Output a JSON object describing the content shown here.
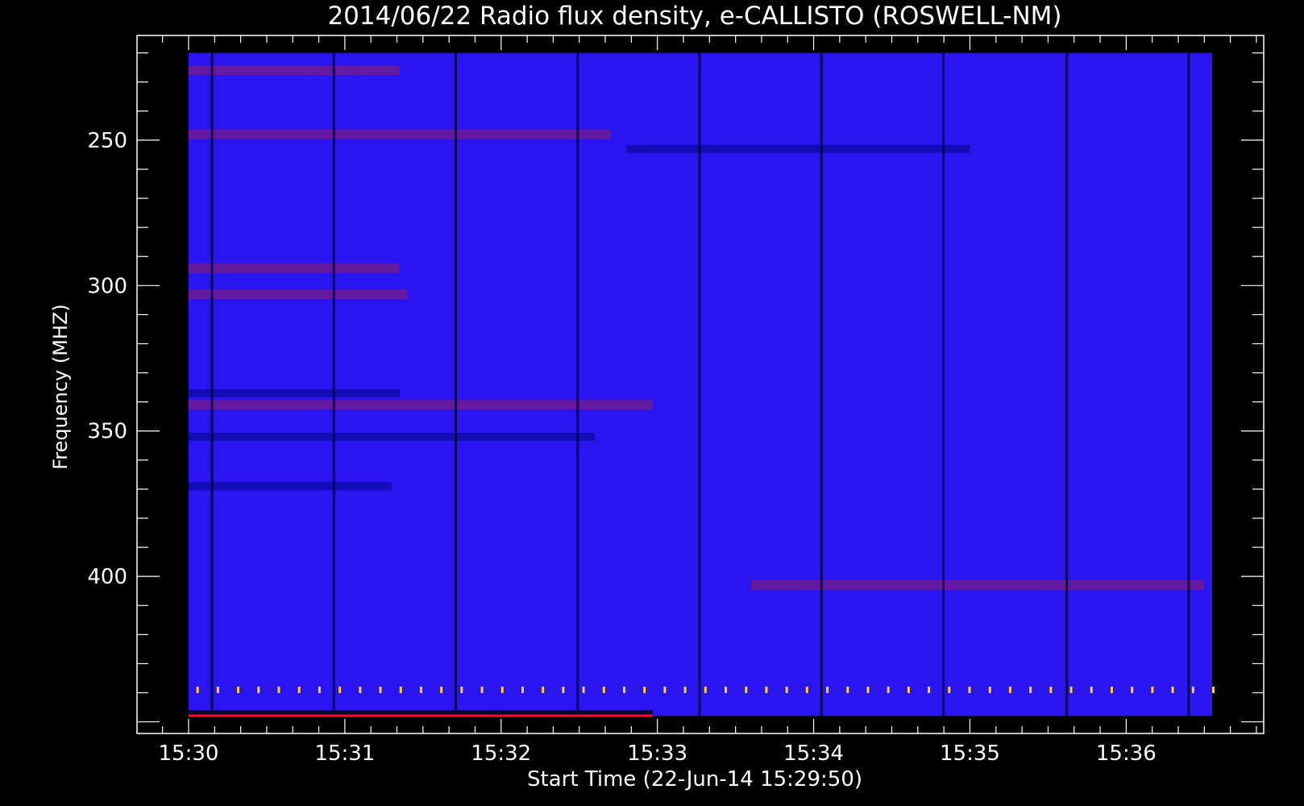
{
  "chart_data": {
    "type": "heatmap",
    "title": "2014/06/22  Radio flux density, e-CALLISTO (ROSWELL-NM)",
    "xlabel": "Start Time (22-Jun-14 15:29:50)",
    "ylabel": "Frequency (MHZ)",
    "x_ticks": [
      "15:30",
      "15:31",
      "15:32",
      "15:33",
      "15:34",
      "15:35",
      "15:36"
    ],
    "x_tick_minutes": [
      0,
      1,
      2,
      3,
      4,
      5,
      6
    ],
    "xlim_minutes_after_1530": [
      -0.33,
      6.88
    ],
    "data_end_minutes": 6.55,
    "y_ticks": [
      250,
      300,
      350,
      400
    ],
    "ylim": [
      214,
      454
    ],
    "y_inverted": true,
    "data_freq_range": [
      220,
      448
    ],
    "colors": {
      "background_level": "#2a14f0",
      "enhanced_level": "#7a1a86",
      "low_level": "#0a0aa0",
      "spike_level": "#ffd020",
      "calibration_line": "#ff1010"
    },
    "enhanced_bands_mhz": [
      {
        "freq": 226,
        "t0": 0.0,
        "t1": 1.35
      },
      {
        "freq": 248,
        "t0": 0.0,
        "t1": 2.7
      },
      {
        "freq": 294,
        "t0": 0.0,
        "t1": 1.35
      },
      {
        "freq": 303,
        "t0": 0.0,
        "t1": 1.4
      },
      {
        "freq": 341,
        "t0": 0.0,
        "t1": 2.97
      },
      {
        "freq": 403,
        "t0": 3.6,
        "t1": 6.5
      }
    ],
    "low_bands_mhz": [
      {
        "freq": 337,
        "t0": 0.0,
        "t1": 1.35
      },
      {
        "freq": 352,
        "t0": 0.0,
        "t1": 2.6
      },
      {
        "freq": 369,
        "t0": 0.0,
        "t1": 1.3
      },
      {
        "freq": 253,
        "t0": 2.8,
        "t1": 5.0
      }
    ],
    "dark_columns_minutes": [
      0.15,
      0.93,
      1.71,
      2.49,
      3.27,
      4.05,
      4.83,
      5.62,
      6.4
    ],
    "spike_row_mhz": 439
  }
}
